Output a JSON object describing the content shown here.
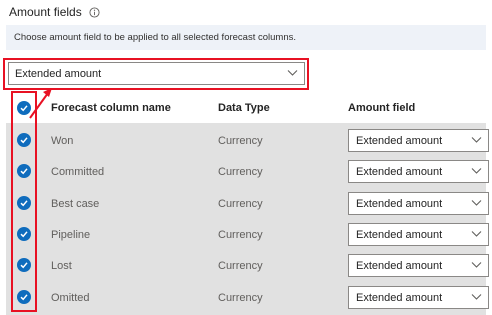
{
  "section": {
    "title": "Amount fields",
    "info_icon": "info-icon",
    "description": "Choose amount field to be applied to all selected forecast columns."
  },
  "bulk_dropdown": {
    "value": "Extended amount",
    "icon": "chevron-down-icon"
  },
  "table": {
    "columns": {
      "forecast_column_name": "Forecast column name",
      "data_type": "Data Type",
      "amount_field": "Amount field"
    },
    "select_all_checked": true,
    "rows": [
      {
        "name": "Won",
        "data_type": "Currency",
        "amount_field": "Extended amount",
        "checked": true
      },
      {
        "name": "Committed",
        "data_type": "Currency",
        "amount_field": "Extended amount",
        "checked": true
      },
      {
        "name": "Best case",
        "data_type": "Currency",
        "amount_field": "Extended amount",
        "checked": true
      },
      {
        "name": "Pipeline",
        "data_type": "Currency",
        "amount_field": "Extended amount",
        "checked": true
      },
      {
        "name": "Lost",
        "data_type": "Currency",
        "amount_field": "Extended amount",
        "checked": true
      },
      {
        "name": "Omitted",
        "data_type": "Currency",
        "amount_field": "Extended amount",
        "checked": true
      }
    ]
  },
  "colors": {
    "accent": "#0f6cbd",
    "annotation": "#e81123",
    "info_bar": "#eef2f8",
    "grid_bg": "#e1e1e1"
  }
}
